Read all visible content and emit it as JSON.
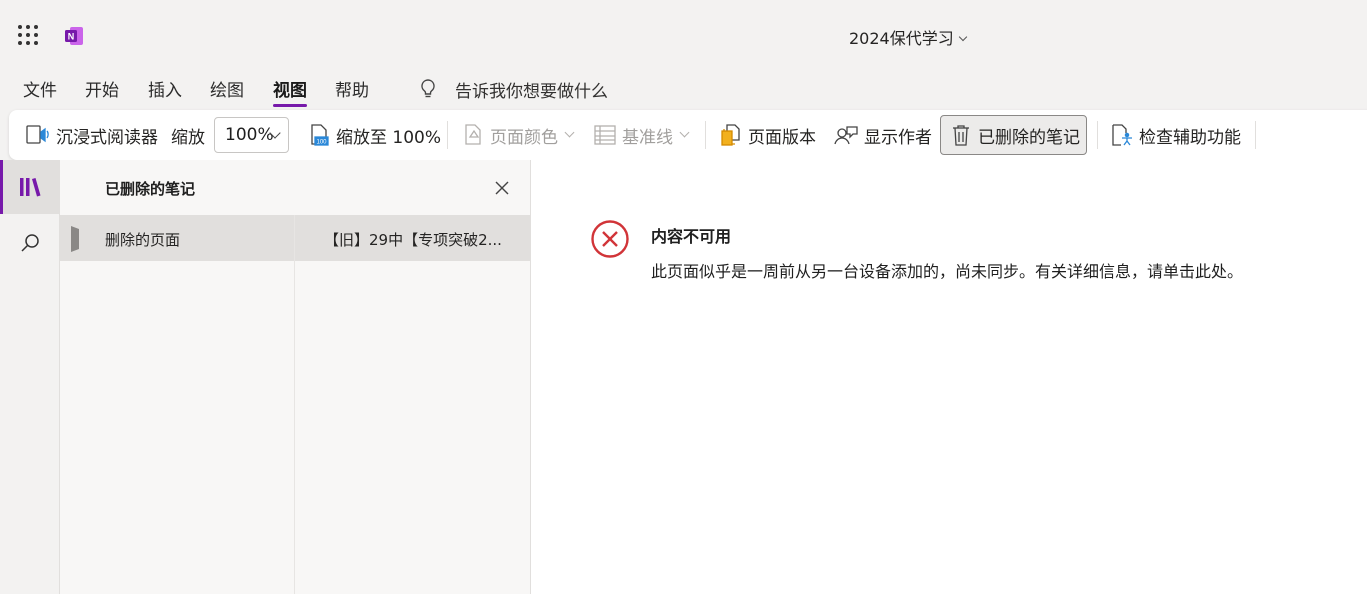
{
  "app": {
    "doc_title": "2024保代学习"
  },
  "menu": {
    "tabs": [
      "文件",
      "开始",
      "插入",
      "绘图",
      "视图",
      "帮助"
    ],
    "active_tab": "视图",
    "tell_me": "告诉我你想要做什么"
  },
  "ribbon": {
    "immersive_reader": "沉浸式阅读器",
    "zoom_label": "缩放",
    "zoom_value": "100%",
    "zoom_to_100": "缩放至 100%",
    "page_color": "页面颜色",
    "rule_lines": "基准线",
    "page_versions": "页面版本",
    "show_authors": "显示作者",
    "deleted_notes": "已删除的笔记",
    "accessibility": "检查辅助功能"
  },
  "deleted_pane": {
    "title": "已删除的笔记",
    "section_label": "删除的页面",
    "page_label": "【旧】29中【专项突破2..."
  },
  "content": {
    "title": "内容不可用",
    "message": "此页面似乎是一周前从另一台设备添加的，尚未同步。有关详细信息，请单击此处。"
  },
  "colors": {
    "accent": "#7719aa",
    "error": "#d13438"
  },
  "icons": [
    "apps-icon",
    "onenote-logo-icon",
    "lightbulb-icon",
    "immersive-reader-icon",
    "zoom-100-icon",
    "page-color-icon",
    "rule-lines-icon",
    "page-versions-icon",
    "show-authors-icon",
    "trash-icon",
    "accessibility-icon",
    "notebooks-icon",
    "search-icon",
    "close-icon",
    "section-tab-icon",
    "error-circle-icon"
  ]
}
